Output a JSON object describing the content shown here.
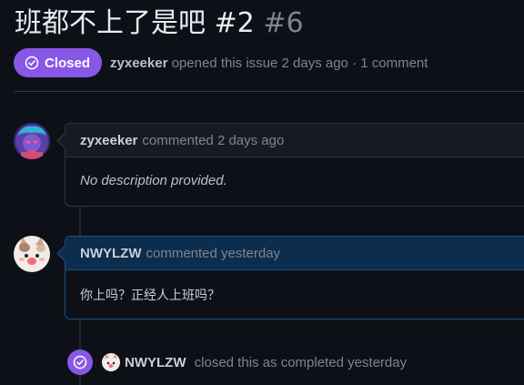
{
  "issue": {
    "title": "班都不上了是吧 #2",
    "number": "#6",
    "status_label": "Closed",
    "status_color": "#8957e5",
    "author": "zyxeeker",
    "meta_text": "opened this issue 2 days ago · 1 comment"
  },
  "comments": [
    {
      "author": "zyxeeker",
      "action": "commented 2 days ago",
      "body": "No description provided.",
      "avatar_icon": "purple-cartoon-avatar-icon"
    },
    {
      "author": "NWYLZW",
      "action": "commented yesterday",
      "body": "你上吗？正经人上班吗？",
      "avatar_icon": "cat-avatar-icon"
    }
  ],
  "event": {
    "icon": "check-circle-icon",
    "author": "NWYLZW",
    "text": "closed this as completed yesterday"
  }
}
